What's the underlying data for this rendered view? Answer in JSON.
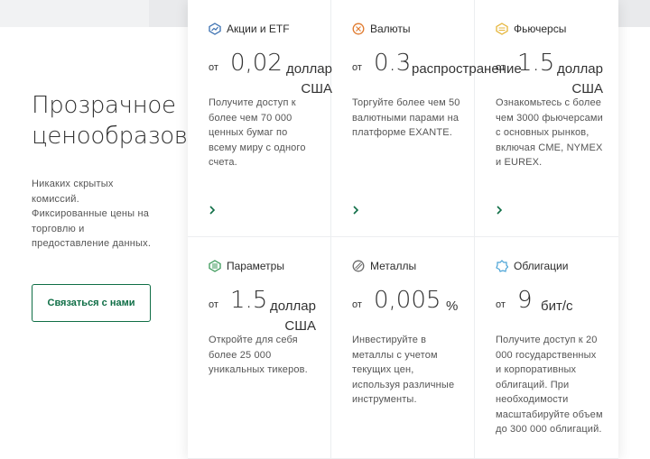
{
  "hero": {
    "title_line1": "Прозрачное",
    "title_line2": "ценообразование",
    "description": "Никаких скрытых комиссий. Фиксированные цены на торговлю и предоставление данных.",
    "cta_label": "Связаться с нами"
  },
  "colors": {
    "accent": "#0f6e46",
    "icon_blue": "#3a6fb0",
    "icon_orange": "#e07a2e",
    "icon_yellow": "#e5b53a",
    "icon_green": "#3d9a5a",
    "icon_gray": "#6b6b6b",
    "icon_lightblue": "#4aa3d6"
  },
  "cards": [
    {
      "icon": "chart-icon",
      "title": "Акции и ETF",
      "from": "от",
      "value": "0,02",
      "unit_line1": "доллар",
      "unit_line2": "США",
      "description": "Получите доступ к более чем 70 000 ценных бумаг по всему миру с одного счета."
    },
    {
      "icon": "currency-icon",
      "title": "Валюты",
      "from": "от",
      "value": "0.3",
      "unit_line1": "распространение",
      "unit_line2": "",
      "description": "Торгуйте более чем 50 валютными парами на платформе EXANTE."
    },
    {
      "icon": "futures-icon",
      "title": "Фьючерсы",
      "from": "от",
      "value": "1.5",
      "unit_line1": "доллар",
      "unit_line2": "США",
      "description": "Ознакомьтесь с более чем 3000 фьючерсами с основных рынков, включая CME, NYMEX и EUREX."
    },
    {
      "icon": "options-icon",
      "title": "Параметры",
      "from": "от",
      "value": "1.5",
      "unit_line1": "доллар",
      "unit_line2": "США",
      "description": "Откройте для себя более 25 000 уникальных тикеров."
    },
    {
      "icon": "metals-icon",
      "title": "Металлы",
      "from": "от",
      "value": "0,005",
      "unit_line1": "%",
      "unit_line2": "",
      "description": "Инвестируйте в металлы с учетом текущих цен, используя различные инструменты."
    },
    {
      "icon": "bonds-icon",
      "title": "Облигации",
      "from": "от",
      "value": "9",
      "unit_line1": "бит/с",
      "unit_line2": "",
      "description": "Получите доступ к 20 000 государственных и корпоративных облигаций. При необходимости масштабируйте объем до 300 000 облигаций."
    }
  ]
}
